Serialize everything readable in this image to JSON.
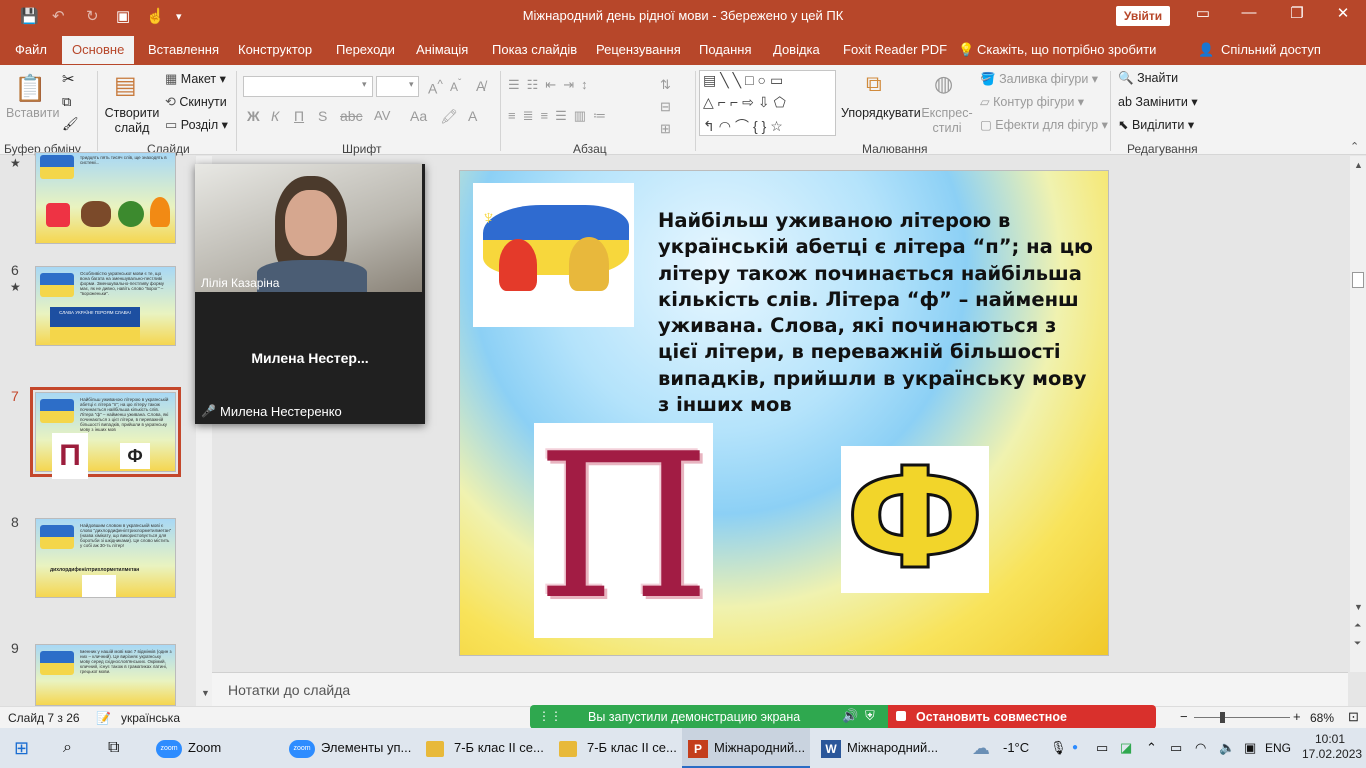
{
  "titlebar": {
    "title": "Міжнародний день рідної мови  -  Збережено у цей ПК",
    "signin": "Увійти"
  },
  "tabs": [
    "Файл",
    "Основне",
    "Вставлення",
    "Конструктор",
    "Переходи",
    "Анімація",
    "Показ слайдів",
    "Рецензування",
    "Подання",
    "Довідка",
    "Foxit Reader PDF"
  ],
  "tellme": "Скажіть, що потрібно зробити",
  "share": "Спільний доступ",
  "ribbon": {
    "clipboard": {
      "paste": "Вставити",
      "group": "Буфер обміну"
    },
    "slides": {
      "new_slide": "Створити слайд",
      "layout": "Макет",
      "reset": "Скинути",
      "section": "Розділ",
      "group": "Слайди"
    },
    "font": {
      "bold": "Ж",
      "italic": "К",
      "underline": "П",
      "strike": "S",
      "group": "Шрифт"
    },
    "paragraph": {
      "group": "Абзац"
    },
    "drawing": {
      "arrange": "Упорядкувати",
      "quick_styles": "Експрес-стилі",
      "fill": "Заливка фігури",
      "outline": "Контур фігури",
      "effects": "Ефекти для фігур",
      "group": "Малювання"
    },
    "editing": {
      "find": "Знайти",
      "replace": "Замінити",
      "select": "Виділити",
      "group": "Редагування"
    }
  },
  "thumbnails": [
    {
      "num": "",
      "star": "★",
      "text": "тридцять пять тисяч слів, ще знаходять в системі..."
    },
    {
      "num": "6",
      "star": "★",
      "text": "Особливістю української мови є те, що вона багата на зменшувально-пестливі форми. Зменшувально-пестливу форму має, як не дивно, навіть слово \"ворог\" – \"вороженьки\".",
      "banner": "СЛАВА УКРАЇНІ! ГЕРОЯМ СЛАВА!"
    },
    {
      "num": "7",
      "star": "",
      "text": "Найбільш уживаною літерою в українській абетці є літера \"п\"; на цю літеру також починається найбільша кількість слів. Літера \"ф\" – найменш уживана. Слова, які починаються з цієї літери, в переважній більшості випадків, прийшли в українську мову з інших мов"
    },
    {
      "num": "8",
      "star": "",
      "text": "Найдовшим словом в українській мові є слово \"дихлордифенілтрихлорметилметан\" (назва хімікату, що використовується для боротьби зі шкідниками). Це слово містить у собі аж 30-ть літер!",
      "word": "дихлордифенілтрихлорметилметан"
    },
    {
      "num": "9",
      "star": "",
      "text": "Іменник у нашій мові має 7 відмінків (один з них – кличний). Це вирізняє українську мову серед східнослов'янських. Окрімий, кличний, існує також в граматиках латині, грецької мови."
    }
  ],
  "zoom": {
    "participant1": "Лілія Казаріна",
    "participant2_big": "Милена  Нестер...",
    "participant2": "Милена Нестеренко"
  },
  "slide": {
    "text": "Найбільш уживаною літерою в українській абетці є літера “п”; на цю літеру також починається найбільша кількість слів. Літера “ф” – найменш уживана. Слова, які починаються з цієї літери, в переважній більшості випадків, прийшли в українську мову з інших мов",
    "letter_p": "П",
    "letter_f": "Ф"
  },
  "notes_placeholder": "Нотатки до слайда",
  "status": {
    "slide_count": "Слайд 7 з 26",
    "language": "українська",
    "zoom": "68%"
  },
  "sharebar": {
    "showing": "Вы запустили демонстрацию экрана",
    "stop": "Остановить совместное использование"
  },
  "taskbar": {
    "items": [
      "Zoom",
      "Элементы уп...",
      "7-Б клас II се...",
      "7-Б клас II се...",
      "Міжнародний...",
      "Міжнародний..."
    ],
    "weather": "-1°C",
    "lang": "ENG",
    "time": "10:01",
    "date": "17.02.2023"
  },
  "colors": {
    "accent": "#b7472a",
    "share_green": "#2fa84f",
    "stop_red": "#d9302c"
  }
}
